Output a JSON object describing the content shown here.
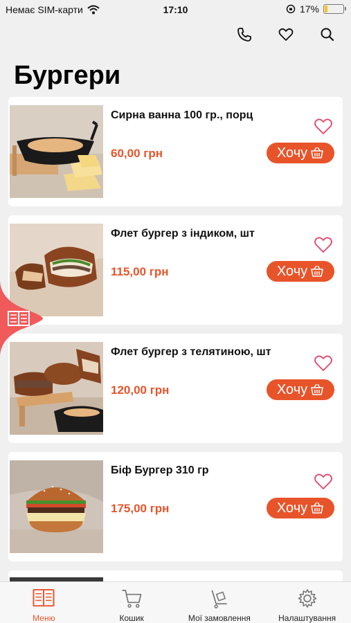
{
  "status_bar": {
    "carrier": "Немає SIM-карти",
    "time": "17:10",
    "battery": "17%",
    "battery_level": 0.17
  },
  "header": {
    "title": "Бургери"
  },
  "colors": {
    "accent": "#e8542a",
    "background": "#f0f0f0",
    "card": "#ffffff"
  },
  "products": [
    {
      "name": "Сирна ванна 100 гр., порц",
      "price": "60,00 грн",
      "button": "Хочу",
      "image": "cheese-sauce-bowl"
    },
    {
      "name": "Флет бургер з індиком, шт",
      "price": "115,00 грн",
      "button": "Хочу",
      "image": "flat-burger-turkey"
    },
    {
      "name": "Флет бургер з телятиною, шт",
      "price": "120,00 грн",
      "button": "Хочу",
      "image": "flat-burger-veal"
    },
    {
      "name": "Біф Бургер 310 гр",
      "price": "175,00 грн",
      "button": "Хочу",
      "image": "beef-burger"
    }
  ],
  "tabbar": {
    "items": [
      {
        "label": "Меню",
        "icon": "menu-book-icon",
        "active": true
      },
      {
        "label": "Кошик",
        "icon": "cart-icon",
        "active": false
      },
      {
        "label": "Мої замовлення",
        "icon": "delivery-cart-icon",
        "active": false
      },
      {
        "label": "Налаштування",
        "icon": "gear-icon",
        "active": false
      }
    ]
  }
}
